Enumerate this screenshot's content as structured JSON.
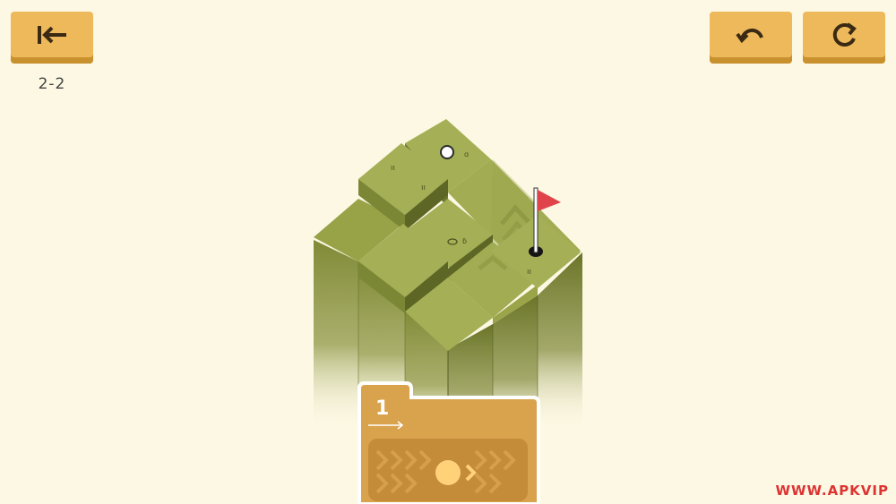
{
  "header": {
    "level": "2-2",
    "back_icon": "back-arrow-icon",
    "undo_icon": "undo-icon",
    "redo_icon": "restart-icon"
  },
  "colors": {
    "background": "#fcf8e3",
    "button": "#eeb95a",
    "grass_top": "#9aa54a",
    "grass_side": "#6f7a2f",
    "flag": "#e0444a",
    "card": "#d9a24c"
  },
  "shot_card": {
    "count": "1",
    "direction_icon": "arrow-right-icon",
    "ball_icon": "ball-icon"
  },
  "watermark": "WWW.APKVIP"
}
